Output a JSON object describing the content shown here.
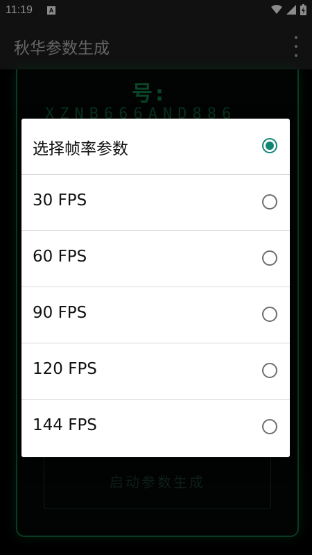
{
  "status_bar": {
    "time": "11:19",
    "notification_icon": "A"
  },
  "app_bar": {
    "title": "秋华参数生成",
    "menu_icon": "more-vert-icon"
  },
  "background": {
    "label": "号:",
    "code": "XZNB666AND886",
    "button_label": "启动参数生成"
  },
  "dialog": {
    "accent_color": "#128575",
    "options": [
      {
        "label": "选择帧率参数",
        "checked": true
      },
      {
        "label": "30 FPS",
        "checked": false
      },
      {
        "label": "60 FPS",
        "checked": false
      },
      {
        "label": "90 FPS",
        "checked": false
      },
      {
        "label": "120 FPS",
        "checked": false
      },
      {
        "label": "144 FPS",
        "checked": false
      }
    ]
  }
}
